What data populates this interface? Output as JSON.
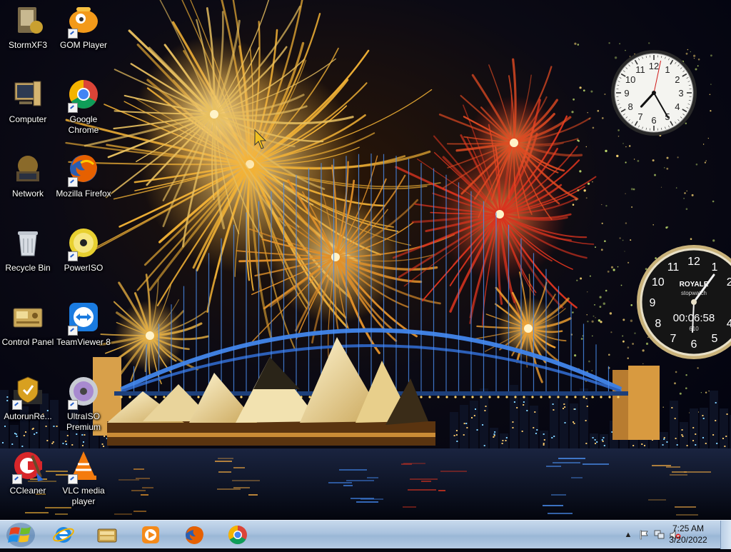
{
  "desktop": {
    "icons": [
      {
        "label": "StormXF3",
        "icon": "stormxf3-icon"
      },
      {
        "label": "GOM Player",
        "icon": "gom-player-icon"
      },
      {
        "label": "Computer",
        "icon": "computer-icon"
      },
      {
        "label": "Google Chrome",
        "icon": "chrome-icon"
      },
      {
        "label": "Network",
        "icon": "network-icon"
      },
      {
        "label": "Mozilla Firefox",
        "icon": "firefox-icon"
      },
      {
        "label": "Recycle Bin",
        "icon": "recycle-bin-icon"
      },
      {
        "label": "PowerISO",
        "icon": "poweriso-icon"
      },
      {
        "label": "Control Panel",
        "icon": "control-panel-icon"
      },
      {
        "label": "TeamViewer 8",
        "icon": "teamviewer-icon"
      },
      {
        "label": "AutorunRe...",
        "icon": "autorun-icon"
      },
      {
        "label": "UltraISO Premium",
        "icon": "ultraiso-icon"
      },
      {
        "label": "CCleaner",
        "icon": "ccleaner-icon"
      },
      {
        "label": "VLC media player",
        "icon": "vlc-icon"
      }
    ]
  },
  "gadgets": {
    "clock": {
      "hour": 7,
      "minute": 25,
      "second": 2
    },
    "stopwatch": {
      "brand": "ROYALE",
      "subtitle": "stopwatch",
      "time": "00:06:58",
      "tenths": "610"
    }
  },
  "taskbar": {
    "start_icon": "windows-logo-icon",
    "pinned": [
      {
        "name": "Internet Explorer",
        "icon": "internet-explorer-icon"
      },
      {
        "name": "Windows Explorer",
        "icon": "file-explorer-icon"
      },
      {
        "name": "Windows Media Player",
        "icon": "media-player-icon"
      },
      {
        "name": "Mozilla Firefox",
        "icon": "firefox-icon"
      },
      {
        "name": "Google Chrome",
        "icon": "chrome-icon"
      }
    ],
    "tray": {
      "icons": [
        "show-hidden-icons-icon",
        "action-center-flag-icon",
        "network-icon",
        "volume-muted-icon"
      ],
      "time": "7:25 AM",
      "date": "3/20/2022"
    }
  },
  "colors": {
    "taskbar": "#a9c2de",
    "firework_gold": "#f2b236",
    "firework_red": "#d8331e",
    "sky": "#05060f"
  }
}
